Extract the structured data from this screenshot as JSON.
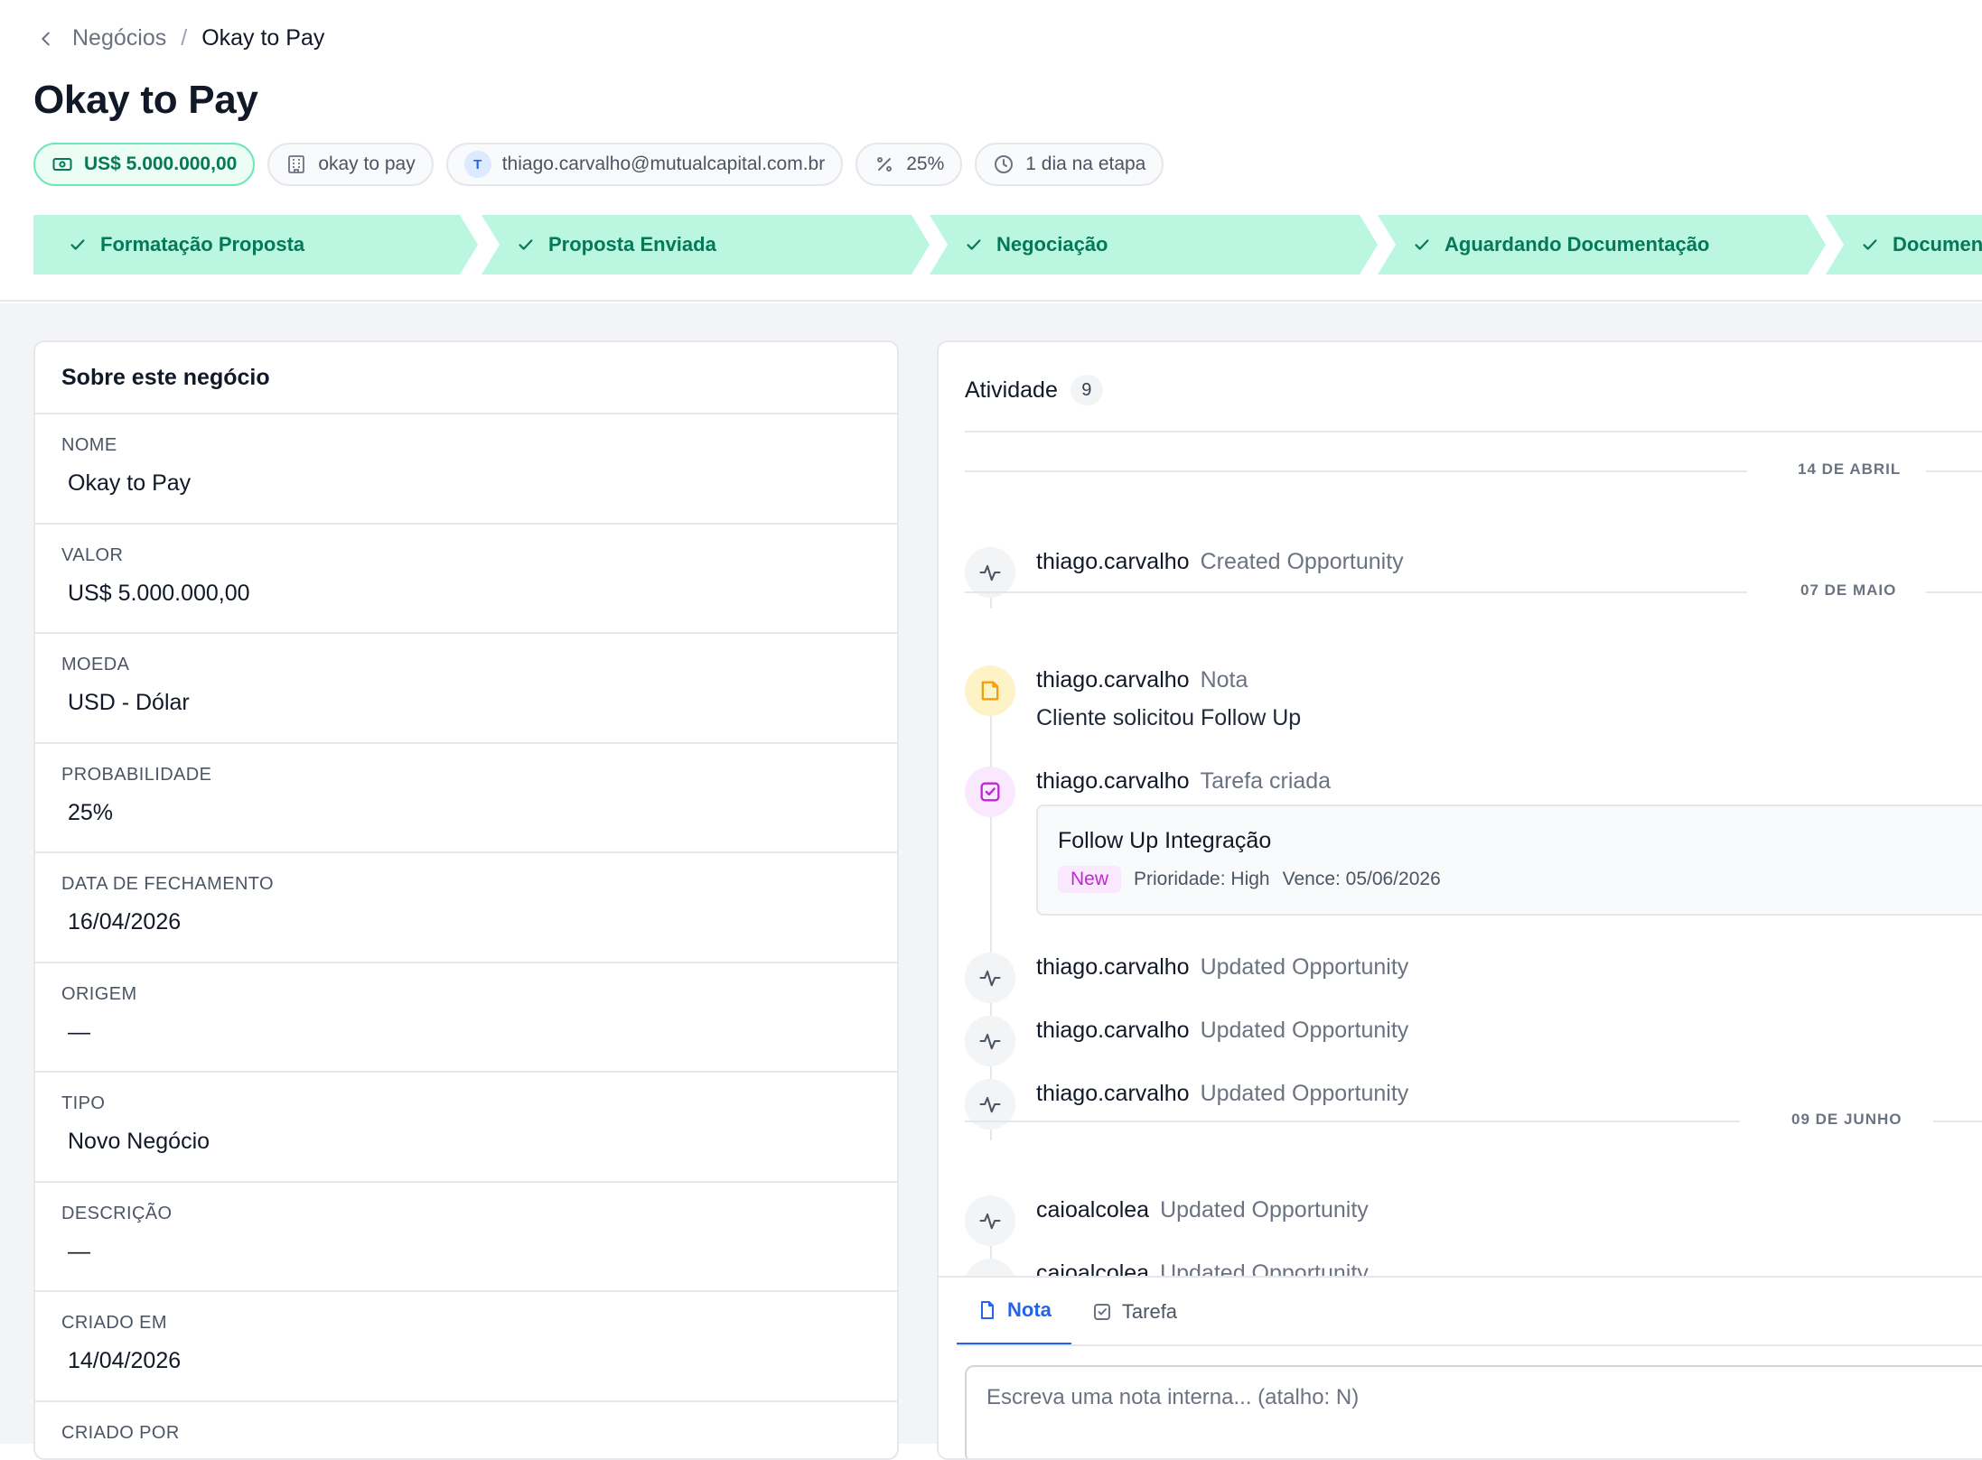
{
  "breadcrumb": {
    "parent": "Negócios",
    "separator": "/",
    "current": "Okay to Pay"
  },
  "page_title": "Okay to Pay",
  "chips": {
    "value": "US$ 5.000.000,00",
    "company": "okay to pay",
    "owner_initial": "T",
    "owner_email": "thiago.carvalho@mutualcapital.com.br",
    "probability": "25%",
    "time_in_stage": "1 dia na etapa"
  },
  "stages": [
    {
      "label": "Formatação Proposta"
    },
    {
      "label": "Proposta Enviada"
    },
    {
      "label": "Negociação"
    },
    {
      "label": "Aguardando Documentação"
    },
    {
      "label": "Documenta"
    }
  ],
  "about": {
    "title": "Sobre este negócio",
    "fields": [
      {
        "label": "NOME",
        "value": "Okay to Pay"
      },
      {
        "label": "VALOR",
        "value": "US$ 5.000.000,00"
      },
      {
        "label": "MOEDA",
        "value": "USD - Dólar"
      },
      {
        "label": "PROBABILIDADE",
        "value": "25%"
      },
      {
        "label": "DATA DE FECHAMENTO",
        "value": "16/04/2026"
      },
      {
        "label": "ORIGEM",
        "value": "—"
      },
      {
        "label": "TIPO",
        "value": "Novo Negócio"
      },
      {
        "label": "DESCRIÇÃO",
        "value": "—"
      },
      {
        "label": "CRIADO EM",
        "value": "14/04/2026"
      },
      {
        "label": "CRIADO POR",
        "value": ""
      }
    ]
  },
  "activity": {
    "title": "Atividade",
    "count": "9",
    "dates": [
      "14 DE ABRIL",
      "07 DE MAIO",
      "09 DE JUNHO"
    ],
    "items": [
      {
        "user": "thiago.carvalho",
        "action": "Created Opportunity"
      },
      {
        "user": "thiago.carvalho",
        "action": "Nota",
        "body": "Cliente solicitou Follow Up"
      },
      {
        "user": "thiago.carvalho",
        "action": "Tarefa criada",
        "task": {
          "title": "Follow Up Integração",
          "status": "New",
          "priority": "Prioridade: High",
          "due": "Vence: 05/06/2026"
        }
      },
      {
        "user": "thiago.carvalho",
        "action": "Updated Opportunity"
      },
      {
        "user": "thiago.carvalho",
        "action": "Updated Opportunity"
      },
      {
        "user": "thiago.carvalho",
        "action": "Updated Opportunity"
      },
      {
        "user": "caioalcolea",
        "action": "Updated Opportunity"
      },
      {
        "user": "caioalcolea",
        "action": "Updated Opportunity"
      }
    ]
  },
  "composer": {
    "tab_note": "Nota",
    "tab_task": "Tarefa",
    "placeholder": "Escreva uma nota interna... (atalho: N)"
  },
  "colors": {
    "accent": "#2563eb",
    "stage_bg": "#bbf7e0",
    "stage_text": "#047857",
    "task_badge": "#c026d3",
    "note_icon": "#f59e0b"
  }
}
